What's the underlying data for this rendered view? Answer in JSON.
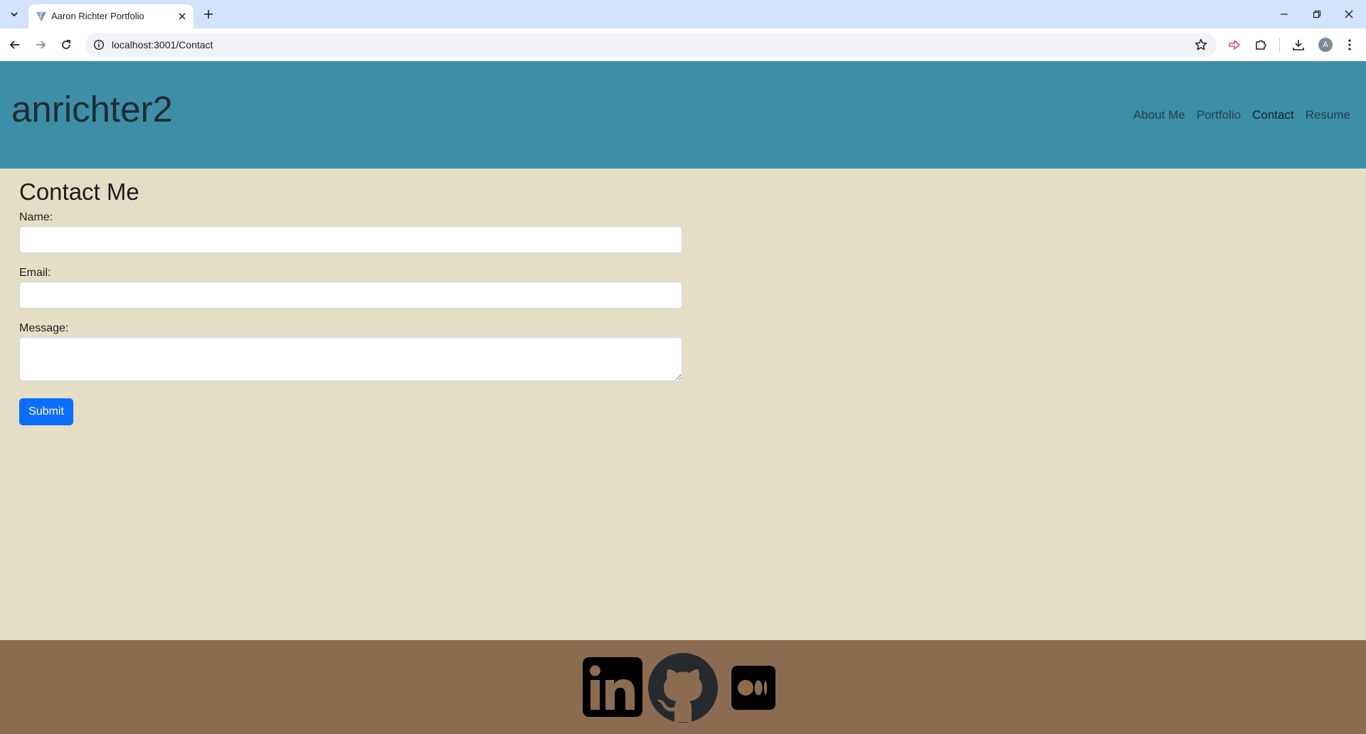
{
  "browser": {
    "tab_title": "Aaron Richter Portfolio",
    "url": "localhost:3001/Contact",
    "profile_initial": "A"
  },
  "header": {
    "site_title": "anrichter2",
    "nav": {
      "about": "About Me",
      "portfolio": "Portfolio",
      "contact": "Contact",
      "resume": "Resume"
    },
    "active_nav": "Contact"
  },
  "contact": {
    "heading": "Contact Me",
    "name_label": "Name:",
    "name_value": "",
    "email_label": "Email:",
    "email_value": "",
    "message_label": "Message:",
    "message_value": "",
    "submit_label": "Submit"
  },
  "footer": {
    "social_icons": [
      "linkedin-icon",
      "github-icon",
      "medium-icon"
    ]
  },
  "colors": {
    "header_bg": "#3d8ea7",
    "page_bg": "#e5dec6",
    "footer_bg": "#8c6c51",
    "submit_bg": "#0d6efd"
  }
}
